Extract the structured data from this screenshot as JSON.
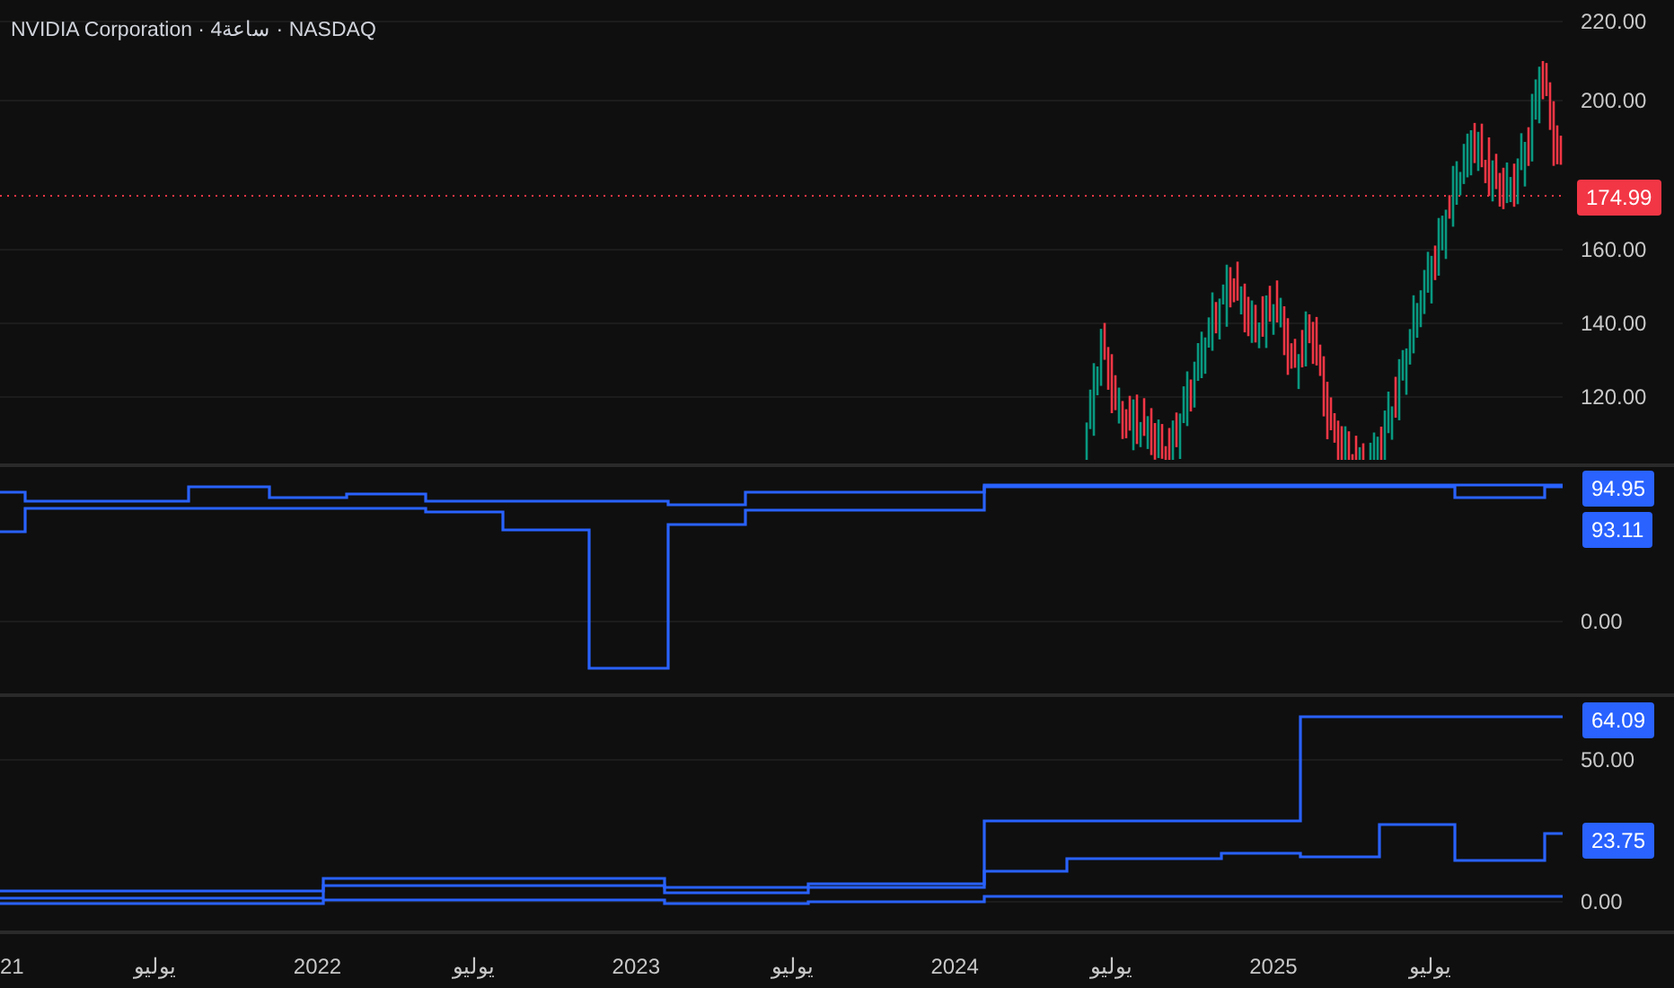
{
  "header": {
    "title": "NVIDIA Corporation · 4ساعة · NASDAQ"
  },
  "panes": [
    {
      "axis_labels": [
        "220.00",
        "200.00",
        "160.00",
        "140.00",
        "120.00"
      ],
      "value_tags": [
        {
          "text": "174.99",
          "kind": "price"
        }
      ]
    },
    {
      "axis_labels": [
        "0.00"
      ],
      "value_tags": [
        {
          "text": "94.95",
          "kind": "line"
        },
        {
          "text": "93.11",
          "kind": "line"
        }
      ]
    },
    {
      "axis_labels": [
        "50.00",
        "0.00"
      ],
      "value_tags": [
        {
          "text": "64.09",
          "kind": "line"
        },
        {
          "text": "23.75",
          "kind": "line"
        }
      ]
    }
  ],
  "time_axis": [
    "21",
    "يوليو",
    "2022",
    "يوليو",
    "2023",
    "يوليو",
    "2024",
    "يوليو",
    "2025",
    "يوليو"
  ]
}
